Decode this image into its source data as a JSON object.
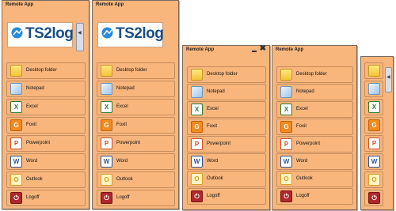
{
  "window_title": "Remote App",
  "logo_text": "TS2log",
  "items": [
    {
      "label": "Desktop folder",
      "icon": "folder-icon"
    },
    {
      "label": "Notepad",
      "icon": "notepad-icon"
    },
    {
      "label": "Excel",
      "icon": "excel-icon"
    },
    {
      "label": "Foxit",
      "icon": "foxit-icon"
    },
    {
      "label": "Powerpoint",
      "icon": "powerpoint-icon"
    },
    {
      "label": "Word",
      "icon": "word-icon"
    },
    {
      "label": "Outlook",
      "icon": "outlook-icon"
    },
    {
      "label": "Logoff",
      "icon": "logoff-icon"
    }
  ],
  "colors": {
    "panel_bg": "#f8b57c",
    "logo_blue": "#1a4f86",
    "logoff_red": "#b0262b"
  }
}
